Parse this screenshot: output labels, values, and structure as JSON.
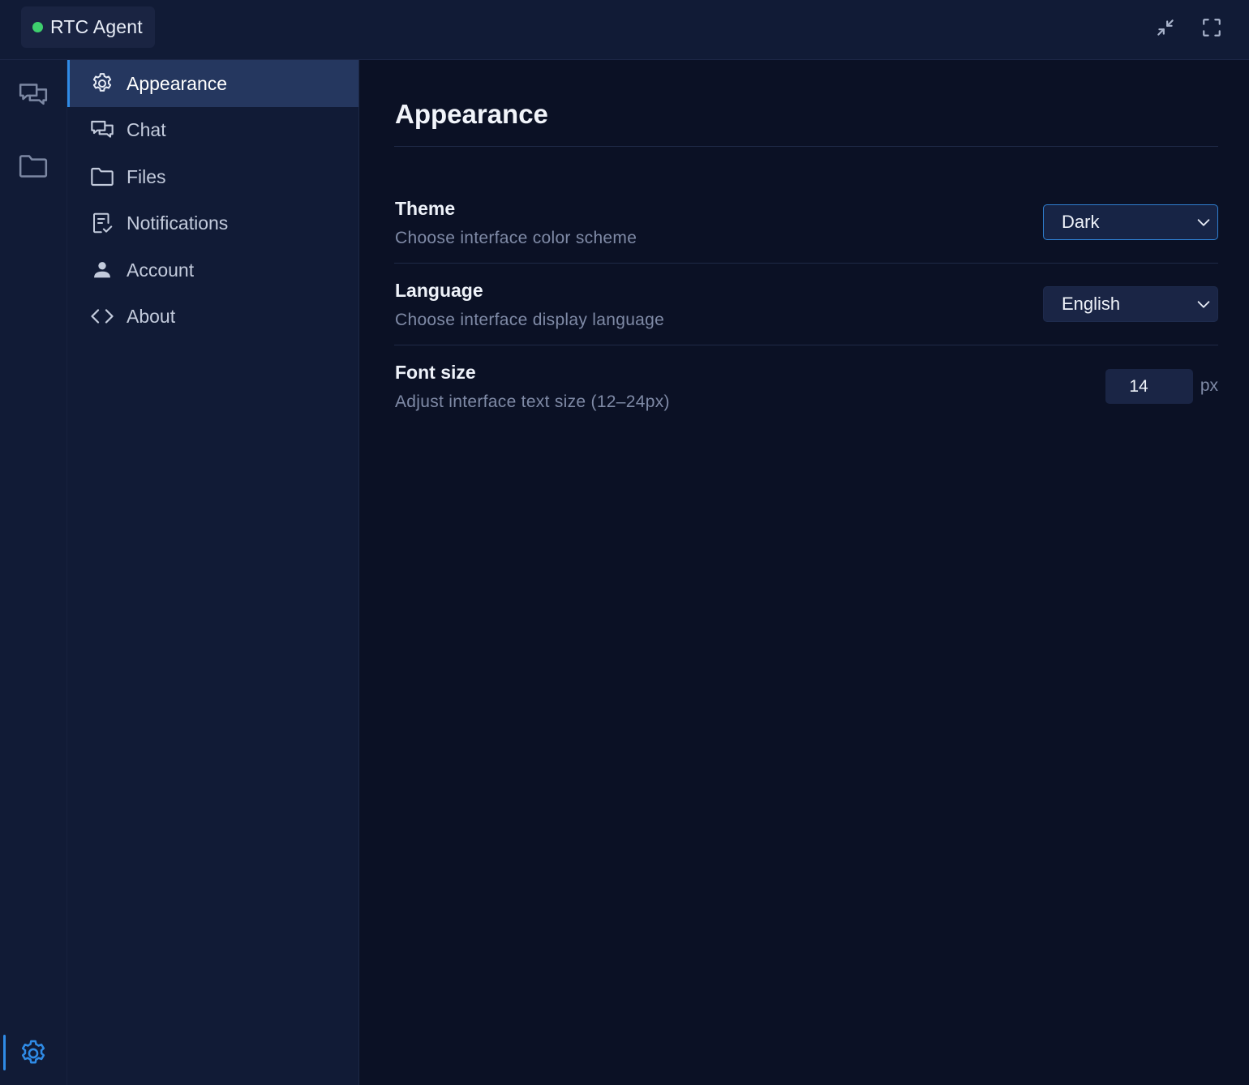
{
  "titlebar": {
    "app_name": "RTC Agent",
    "status_color": "#3ecf6e",
    "buttons": [
      {
        "icon": "collapse-icon"
      },
      {
        "icon": "fullscreen-icon"
      }
    ]
  },
  "rail": {
    "items": [
      {
        "icon": "chat-icon"
      },
      {
        "icon": "folder-icon"
      },
      {
        "icon": "gear-icon",
        "active": true
      }
    ]
  },
  "nav": {
    "items": [
      {
        "label": "Appearance",
        "icon": "gear-icon",
        "active": true
      },
      {
        "label": "Chat",
        "icon": "chat-icon"
      },
      {
        "label": "Files",
        "icon": "folder-icon"
      },
      {
        "label": "Notifications",
        "icon": "checklist-icon"
      },
      {
        "label": "Account",
        "icon": "person-icon"
      },
      {
        "label": "About",
        "icon": "code-icon"
      }
    ]
  },
  "main": {
    "title": "Appearance",
    "settings": {
      "theme": {
        "label": "Theme",
        "description": "Choose interface color scheme",
        "value": "Dark"
      },
      "language": {
        "label": "Language",
        "description": "Choose interface display language",
        "value": "English"
      },
      "font_size": {
        "label": "Font size",
        "description": "Adjust interface text size (12–24px)",
        "value": "14",
        "unit": "px"
      }
    }
  },
  "colors": {
    "accent": "#2f8be6",
    "background": "#0b1125",
    "sidebar": "#111b36",
    "active_nav": "#25375f"
  }
}
